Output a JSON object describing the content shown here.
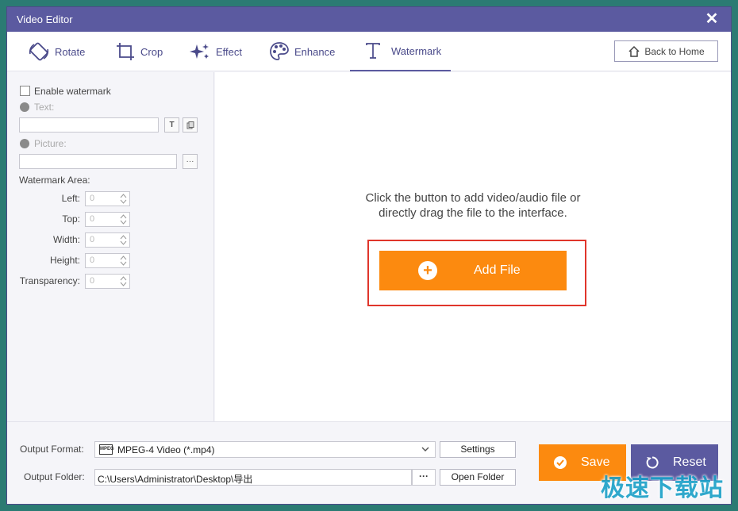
{
  "window": {
    "title": "Video Editor"
  },
  "tabs": [
    {
      "label": "Rotate",
      "icon": "rotate-icon"
    },
    {
      "label": "Crop",
      "icon": "crop-icon"
    },
    {
      "label": "Effect",
      "icon": "effect-icon"
    },
    {
      "label": "Enhance",
      "icon": "enhance-icon"
    },
    {
      "label": "Watermark",
      "icon": "text-icon",
      "active": true
    }
  ],
  "back_home": "Back to Home",
  "sidebar": {
    "enable_watermark": "Enable watermark",
    "text_label": "Text:",
    "picture_label": "Picture:",
    "area_label": "Watermark Area:",
    "text_btn": "T",
    "picture_btn": "···",
    "fields": [
      {
        "label": "Left:",
        "value": "0"
      },
      {
        "label": "Top:",
        "value": "0"
      },
      {
        "label": "Width:",
        "value": "0"
      },
      {
        "label": "Height:",
        "value": "0"
      },
      {
        "label": "Transparency:",
        "value": "0"
      }
    ]
  },
  "preview": {
    "hint_line1": "Click the button to add video/audio file or",
    "hint_line2": "directly drag the file to the interface.",
    "add_file": "Add File"
  },
  "bottom": {
    "output_format_label": "Output Format:",
    "output_format_value": "MPEG-4 Video (*.mp4)",
    "format_badge": "MPEG",
    "settings": "Settings",
    "output_folder_label": "Output Folder:",
    "output_folder_value": "C:\\Users\\Administrator\\Desktop\\导出",
    "browse": "···",
    "open_folder": "Open Folder",
    "save": "Save",
    "reset": "Reset"
  },
  "site_watermark": "极速下载站",
  "colors": {
    "accent": "#5b5aa0",
    "orange": "#fc8a0f",
    "highlight": "#e0352b"
  }
}
